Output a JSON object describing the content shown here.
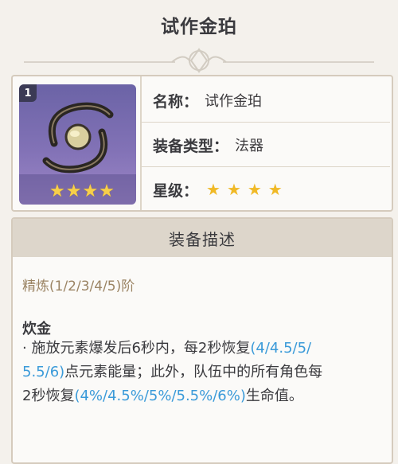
{
  "page": {
    "title": "试作金珀"
  },
  "item": {
    "refine_badge": "1",
    "rarity_stars": "★★★★",
    "name_label": "名称：",
    "name_value": "试作金珀",
    "type_label": "装备类型：",
    "type_value": "法器",
    "star_label": "星级：",
    "star_value": "★★★★"
  },
  "description": {
    "header": "装备描述",
    "refinement": "精炼(1/2/3/4/5)阶",
    "effect_name": "炊金",
    "line1_a": "· 施放元素爆发后6秒内，每2秒恢复",
    "line1_b": "(4/4.5/5/",
    "line2_a": "5.5/6)",
    "line2_b": "点元素能量；此外，队伍中的所有角色每",
    "line3_a": "2秒恢复",
    "line3_b": "(4%/4.5%/5%/5.5%/6%)",
    "line3_c": "生命值。"
  },
  "colors": {
    "highlight": "#3a9ad9",
    "star": "#f0b926",
    "icon_bg": "#7a6db0"
  }
}
